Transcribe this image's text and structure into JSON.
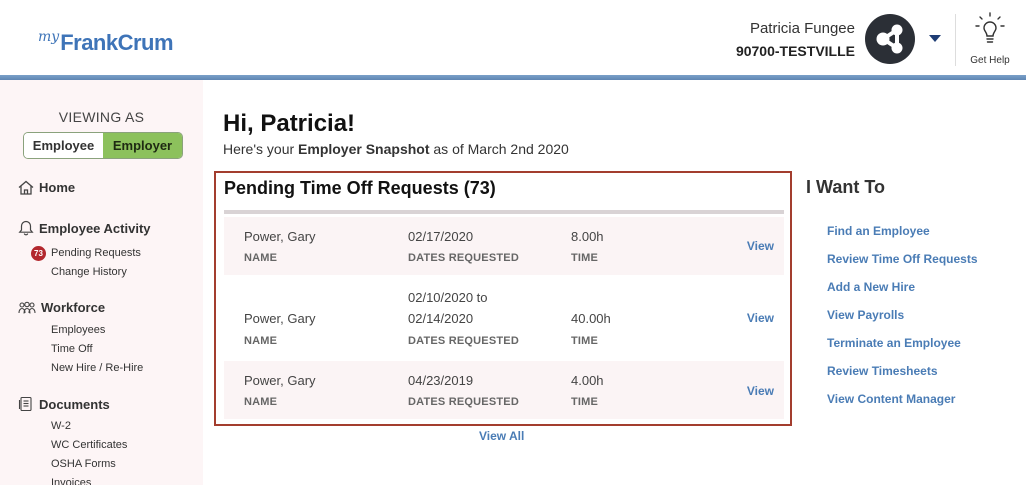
{
  "header": {
    "logo": {
      "prefix": "my",
      "name_part1": "Frank",
      "name_part2": "Crum"
    },
    "user_name": "Patricia Fungee",
    "company": "90700-TESTVILLE",
    "help_label": "Get Help"
  },
  "sidebar": {
    "viewing_as": "VIEWING AS",
    "toggle": {
      "employee": "Employee",
      "employer": "Employer",
      "active": "Employer"
    },
    "home": "Home",
    "employee_activity": {
      "label": "Employee Activity",
      "pending_count": "73",
      "items": [
        "Pending Requests",
        "Change History"
      ]
    },
    "workforce": {
      "label": "Workforce",
      "items": [
        "Employees",
        "Time Off",
        "New Hire / Re-Hire"
      ]
    },
    "documents": {
      "label": "Documents",
      "items": [
        "W-2",
        "WC Certificates",
        "OSHA Forms",
        "Invoices"
      ]
    }
  },
  "main": {
    "greeting": "Hi, Patricia!",
    "snapshot_prefix": "Here's your ",
    "snapshot_bold": "Employer Snapshot",
    "snapshot_suffix": " as of March 2nd 2020",
    "pending": {
      "title": "Pending Time Off Requests (73)",
      "labels": {
        "name": "NAME",
        "dates": "DATES REQUESTED",
        "time": "TIME"
      },
      "view_label": "View",
      "rows": [
        {
          "name": "Power, Gary",
          "dates_line1": "02/17/2020",
          "dates_line2": "",
          "time": "8.00h"
        },
        {
          "name": "Power, Gary",
          "dates_line1": "02/10/2020 to",
          "dates_line2": "02/14/2020",
          "time": "40.00h"
        },
        {
          "name": "Power, Gary",
          "dates_line1": "04/23/2019",
          "dates_line2": "",
          "time": "4.00h"
        }
      ],
      "view_all": "View All"
    }
  },
  "i_want_to": {
    "title": "I Want To",
    "items": [
      "Find an Employee",
      "Review Time Off Requests",
      "Add a New Hire",
      "View Payrolls",
      "Terminate an Employee",
      "Review Timesheets",
      "View Content Manager"
    ]
  },
  "colors": {
    "accent_blue": "#4a7cb5",
    "employer_green": "#8cc15c",
    "badge_red": "#b3282e",
    "box_border": "#a33d2e"
  }
}
